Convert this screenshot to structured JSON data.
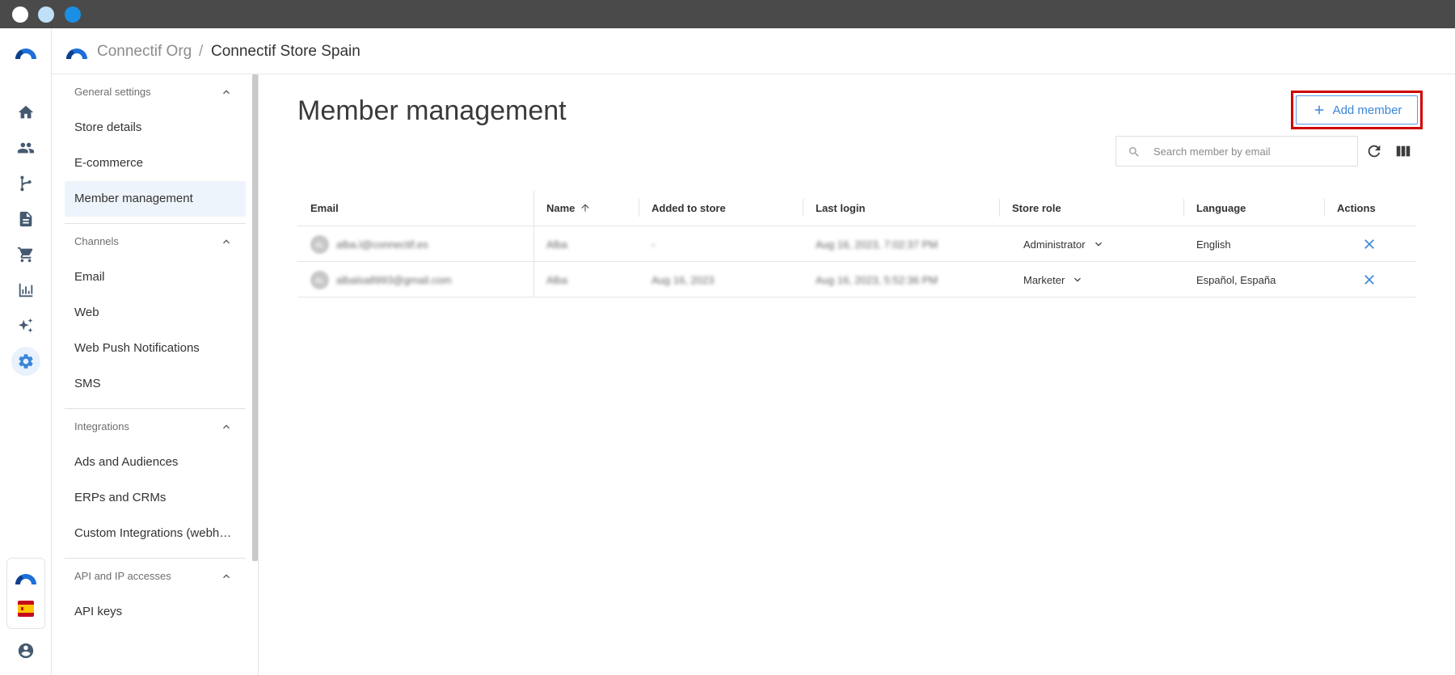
{
  "breadcrumb": {
    "org": "Connectif Org",
    "separator": "/",
    "store": "Connectif Store Spain"
  },
  "rail": {
    "items": [
      {
        "icon": "home-icon"
      },
      {
        "icon": "people-icon"
      },
      {
        "icon": "workflow-icon"
      },
      {
        "icon": "content-icon"
      },
      {
        "icon": "cart-icon"
      },
      {
        "icon": "reports-icon"
      },
      {
        "icon": "sparkles-icon"
      },
      {
        "icon": "gear-icon",
        "active": true
      }
    ],
    "bottom": [
      "connectif-logo",
      "spain-flag-icon",
      "account-icon"
    ]
  },
  "nav": {
    "sections": [
      {
        "title": "General settings",
        "items": [
          "Store details",
          "E-commerce",
          "Member management"
        ]
      },
      {
        "title": "Channels",
        "items": [
          "Email",
          "Web",
          "Web Push Notifications",
          "SMS"
        ]
      },
      {
        "title": "Integrations",
        "items": [
          "Ads and Audiences",
          "ERPs and CRMs",
          "Custom Integrations (webhooks)"
        ]
      },
      {
        "title": "API and IP accesses",
        "items": [
          "API keys"
        ]
      }
    ],
    "active_item": "Member management"
  },
  "main": {
    "title": "Member management",
    "add_button_label": "Add member",
    "search_placeholder": "Search member by email"
  },
  "table": {
    "headers": {
      "email": "Email",
      "name": "Name",
      "added": "Added to store",
      "last_login": "Last login",
      "role": "Store role",
      "language": "Language",
      "actions": "Actions"
    },
    "rows": [
      {
        "avatar": "AL",
        "email": "alba.l@connectif.es",
        "name": "Alba",
        "added": "-",
        "last_login": "Aug 16, 2023, 7:02:37 PM",
        "role": "Administrator",
        "language": "English"
      },
      {
        "avatar": "AL",
        "email": "albalsa8993@gmail.com",
        "name": "Alba",
        "added": "Aug 16, 2023",
        "last_login": "Aug 16, 2023, 5:52:36 PM",
        "role": "Marketer",
        "language": "Español, España"
      }
    ]
  },
  "colors": {
    "accent": "#3a86d9",
    "highlight_border": "#d00000",
    "titlebar": "#4a4a4a"
  }
}
